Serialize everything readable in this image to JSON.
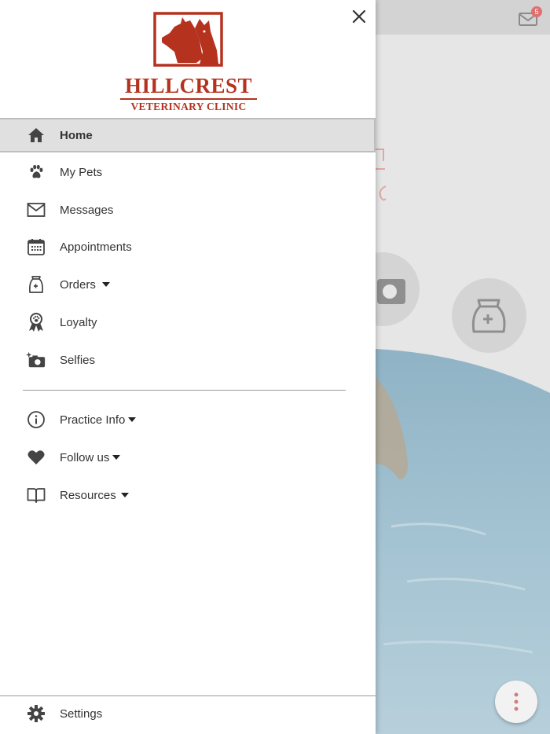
{
  "header": {
    "badge_count": "5"
  },
  "logo": {
    "line1": "HILLCREST",
    "line2": "VETERINARY CLINIC",
    "color": "#b5321f"
  },
  "menu": {
    "home": "Home",
    "my_pets": "My Pets",
    "messages": "Messages",
    "appointments": "Appointments",
    "orders": "Orders",
    "loyalty": "Loyalty",
    "selfies": "Selfies",
    "practice_info": "Practice Info",
    "follow_us": "Follow us",
    "resources": "Resources",
    "settings": "Settings"
  },
  "colors": {
    "active_bg": "#e0e0e0",
    "icon": "#444444",
    "brand": "#b5321f",
    "badge": "#e07070"
  }
}
